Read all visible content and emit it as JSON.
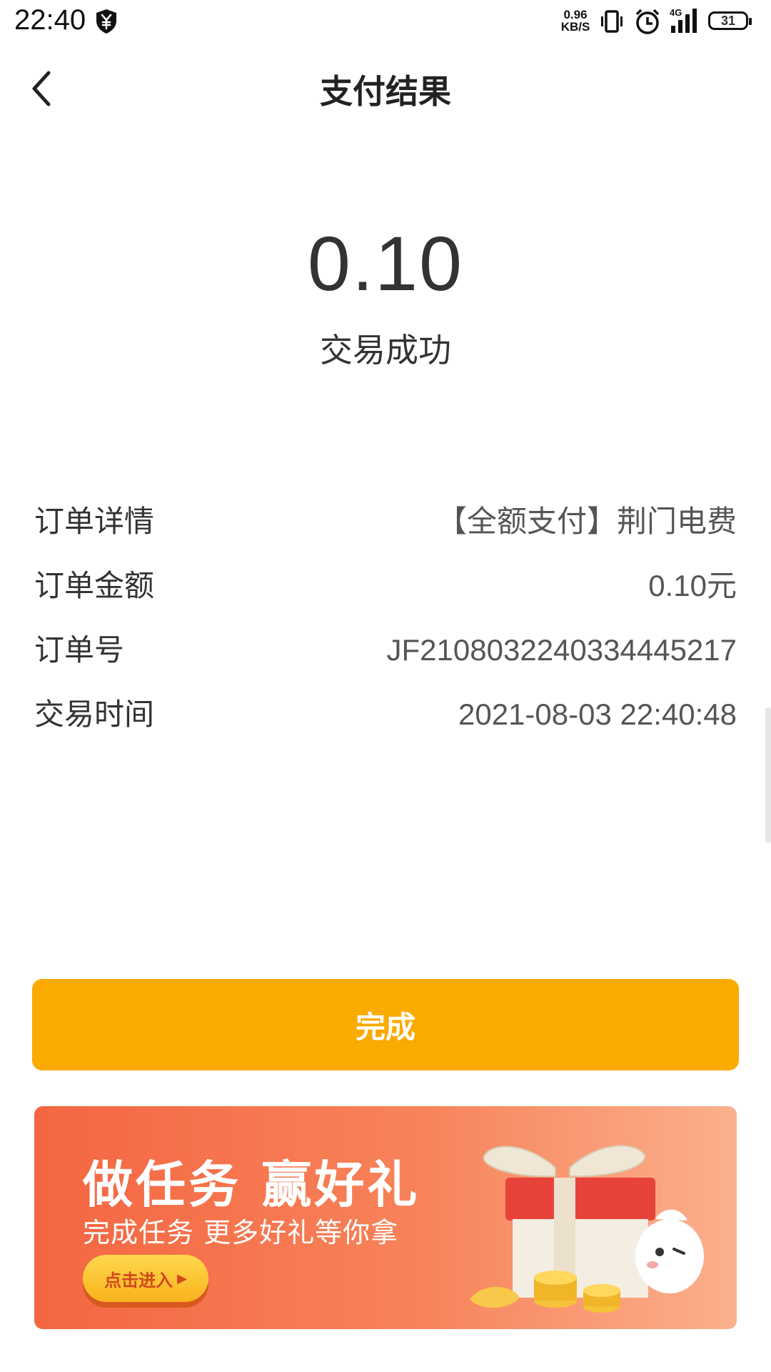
{
  "status_bar": {
    "time": "22:40",
    "net_speed_value": "0.96",
    "net_speed_unit": "KB/S",
    "network_type": "4G",
    "battery_level": "31"
  },
  "header": {
    "title": "支付结果"
  },
  "result": {
    "amount": "0.10",
    "status": "交易成功"
  },
  "details": [
    {
      "label": "订单详情",
      "value": "【全额支付】荆门电费"
    },
    {
      "label": "订单金额",
      "value": "0.10元"
    },
    {
      "label": "订单号",
      "value": "JF2108032240334445217"
    },
    {
      "label": "交易时间",
      "value": "2021-08-03 22:40:48"
    }
  ],
  "actions": {
    "done_label": "完成"
  },
  "promo": {
    "title": "做任务 赢好礼",
    "subtitle": "完成任务 更多好礼等你拿",
    "button_label": "点击进入"
  },
  "colors": {
    "primary": "#fbaa00",
    "promo_gradient_start": "#f46641",
    "promo_gradient_end": "#fbb08d"
  },
  "icons": {
    "back": "chevron-left-icon",
    "status_shield": "yuan-shield-icon",
    "vibrate": "vibrate-icon",
    "alarm": "alarm-icon",
    "signal": "signal-icon",
    "battery": "battery-icon"
  }
}
